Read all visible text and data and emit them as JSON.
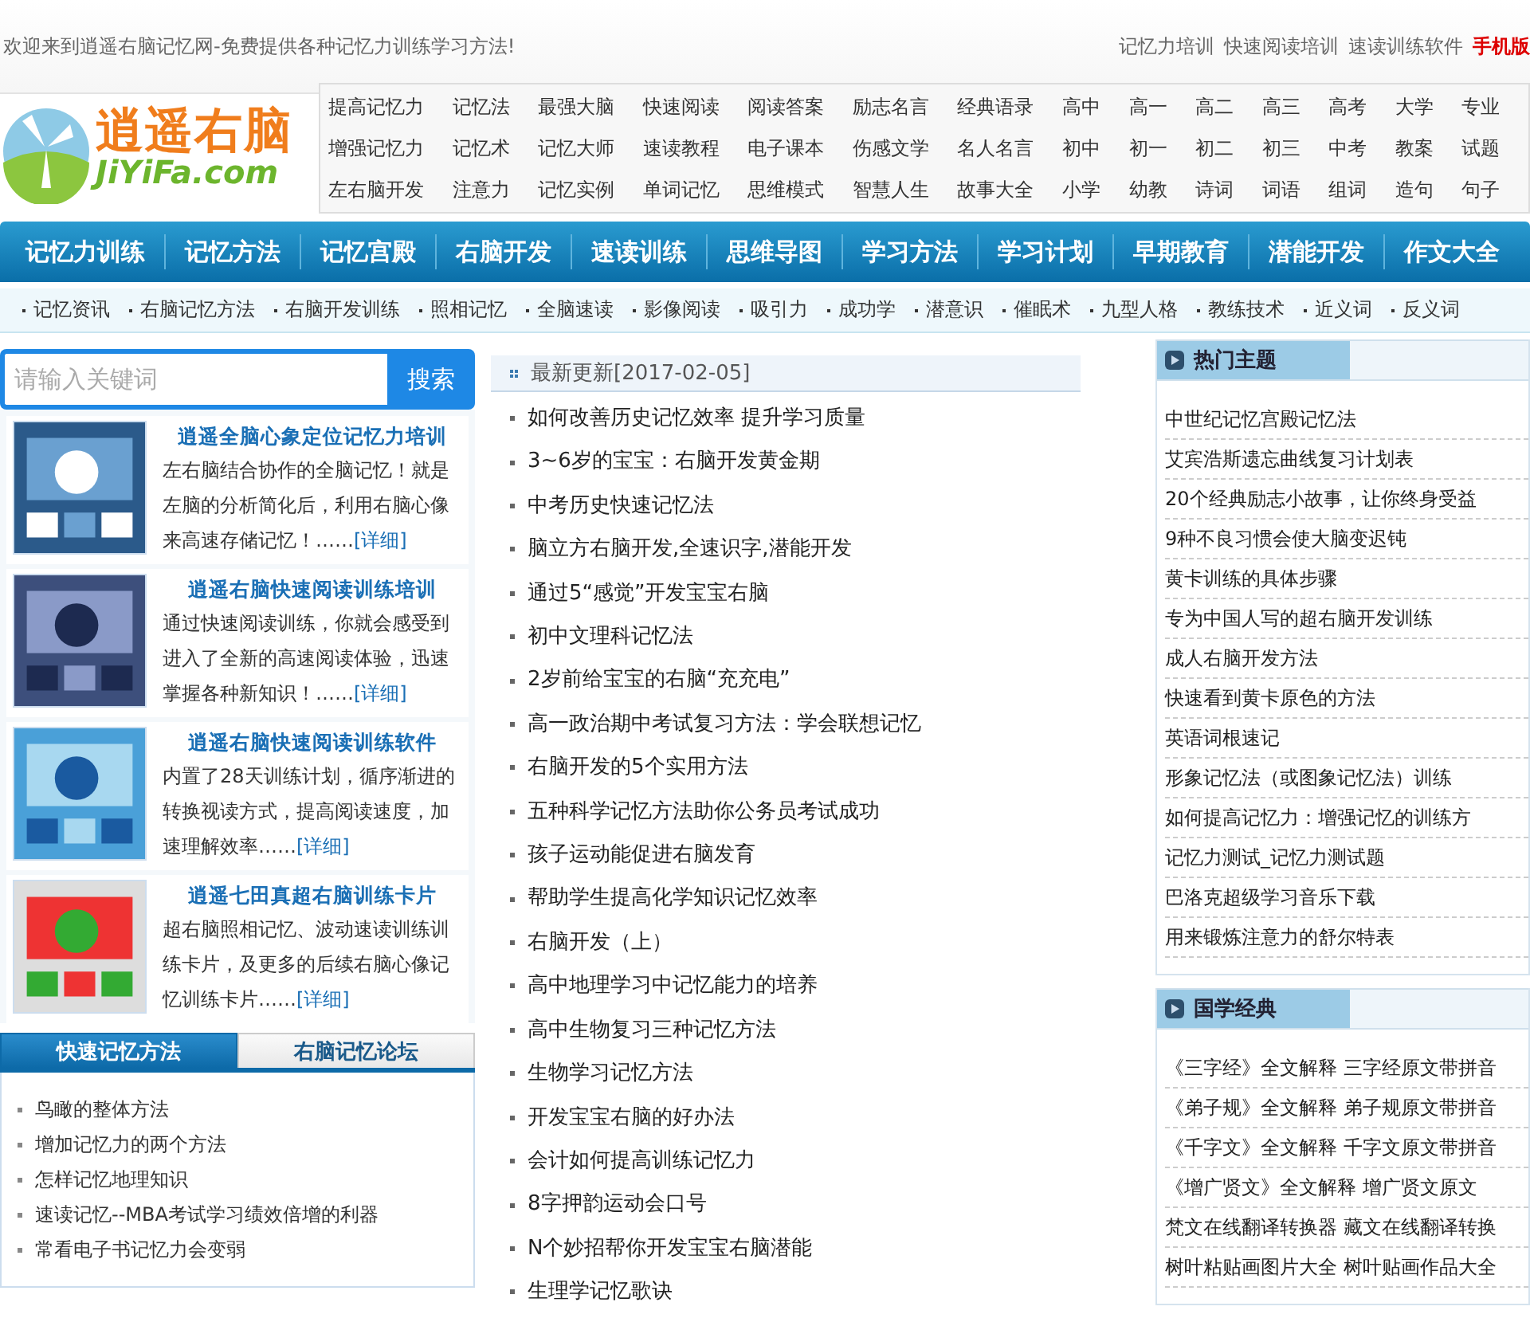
{
  "top_bar": {
    "welcome": "欢迎来到逍遥右脑记忆网-免费提供各种记忆力训练学习方法!",
    "links": [
      "记忆力培训",
      "快速阅读培训",
      "速读训练软件"
    ],
    "mobile": "手机版"
  },
  "logo": {
    "title": "逍遥右脑",
    "domain": "JiYiFa.com"
  },
  "header_links": [
    [
      "提高记忆力",
      "记忆法",
      "最强大脑",
      "快速阅读",
      "阅读答案",
      "励志名言",
      "经典语录",
      "高中",
      "高一",
      "高二",
      "高三",
      "高考",
      "大学",
      "专业"
    ],
    [
      "增强记忆力",
      "记忆术",
      "记忆大师",
      "速读教程",
      "电子课本",
      "伤感文学",
      "名人名言",
      "初中",
      "初一",
      "初二",
      "初三",
      "中考",
      "教案",
      "试题"
    ],
    [
      "左右脑开发",
      "注意力",
      "记忆实例",
      "单词记忆",
      "思维模式",
      "智慧人生",
      "故事大全",
      "小学",
      "幼教",
      "诗词",
      "词语",
      "组词",
      "造句",
      "句子"
    ]
  ],
  "main_nav": [
    "记忆力训练",
    "记忆方法",
    "记忆宫殿",
    "右脑开发",
    "速读训练",
    "思维导图",
    "学习方法",
    "学习计划",
    "早期教育",
    "潜能开发",
    "作文大全"
  ],
  "sub_nav": [
    "记忆资讯",
    "右脑记忆方法",
    "右脑开发训练",
    "照相记忆",
    "全脑速读",
    "影像阅读",
    "吸引力",
    "成功学",
    "潜意识",
    "催眠术",
    "九型人格",
    "教练技术",
    "近义词",
    "反义词"
  ],
  "search": {
    "placeholder": "请输入关键词",
    "button": "搜索"
  },
  "promos": [
    {
      "title": "逍遥全脑心象定位记忆力培训",
      "text": "左右脑结合协作的全脑记忆！就是左脑的分析简化后，利用右脑心像来高速存储记忆！……",
      "more": "[详细]"
    },
    {
      "title": "逍遥右脑快速阅读训练培训",
      "text": "通过快速阅读训练，你就会感受到进入了全新的高速阅读体验，迅速掌握各种新知识！……",
      "more": "[详细]"
    },
    {
      "title": "逍遥右脑快速阅读训练软件",
      "text": "内置了28天训练计划，循序渐进的转换视读方式，提高阅读速度，加速理解效率……",
      "more": "[详细]"
    },
    {
      "title": "逍遥七田真超右脑训练卡片",
      "text": "超右脑照相记忆、波动速读训练训练卡片，及更多的后续右脑心像记忆训练卡片……",
      "more": "[详细]"
    }
  ],
  "tabs": [
    {
      "label": "快速记忆方法",
      "selected": true
    },
    {
      "label": "右脑记忆论坛",
      "selected": false
    }
  ],
  "tab_items": [
    "鸟瞰的整体方法",
    "增加记忆力的两个方法",
    "怎样记忆地理知识",
    "速读记忆--MBA考试学习绩效倍增的利器",
    "常看电子书记忆力会变弱"
  ],
  "latest": {
    "title": "最新更新[2017-02-05]",
    "items": [
      "如何改善历史记忆效率 提升学习质量",
      "3~6岁的宝宝：右脑开发黄金期",
      "中考历史快速记忆法",
      "脑立方右脑开发,全速识字,潜能开发",
      "通过5“感觉”开发宝宝右脑",
      "初中文理科记忆法",
      "2岁前给宝宝的右脑“充充电”",
      "高一政治期中考试复习方法：学会联想记忆",
      "右脑开发的5个实用方法",
      "五种科学记忆方法助你公务员考试成功",
      "孩子运动能促进右脑发育",
      "帮助学生提高化学知识记忆效率",
      "右脑开发（上）",
      "高中地理学习中记忆能力的培养",
      "高中生物复习三种记忆方法",
      "生物学习记忆方法",
      "开发宝宝右脑的好办法",
      "会计如何提高训练记忆力",
      "8字押韵运动会口号",
      "N个妙招帮你开发宝宝右脑潜能",
      "生理学记忆歌诀"
    ]
  },
  "panels": [
    {
      "title": "热门主题",
      "items": [
        "中世纪记忆宫殿记忆法",
        "艾宾浩斯遗忘曲线复习计划表",
        "20个经典励志小故事，让你终身受益",
        "9种不良习惯会使大脑变迟钝",
        "黄卡训练的具体步骤",
        "专为中国人写的超右脑开发训练",
        "成人右脑开发方法",
        "快速看到黄卡原色的方法",
        "英语词根速记",
        "形象记忆法（或图象记忆法）训练",
        "如何提高记忆力：增强记忆的训练方",
        "记忆力测试_记忆力测试题",
        "巴洛克超级学习音乐下载",
        "用来锻炼注意力的舒尔特表"
      ]
    },
    {
      "title": "国学经典",
      "items": [
        "《三字经》全文解释 三字经原文带拼音",
        "《弟子规》全文解释 弟子规原文带拼音",
        "《千字文》全文解释 千字文原文带拼音",
        "《增广贤文》全文解释 增广贤文原文",
        "梵文在线翻译转换器 藏文在线翻译转换",
        "树叶粘贴画图片大全 树叶贴画作品大全"
      ]
    }
  ]
}
